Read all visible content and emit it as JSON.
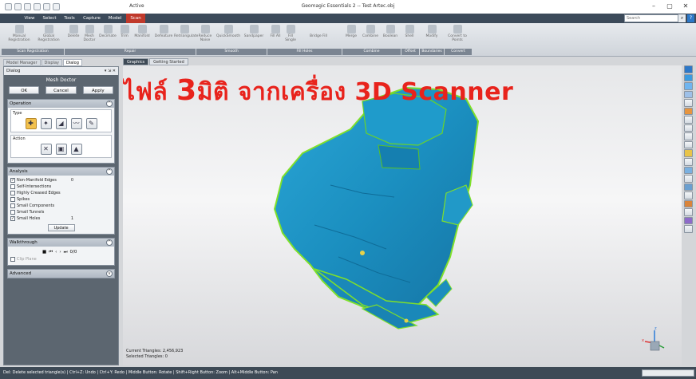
{
  "window": {
    "title": "Geomagic Essentials 2 -- Test Artec.obj",
    "active_context": "Active",
    "minimize": "–",
    "maximize": "▢",
    "close": "✕"
  },
  "tabs": [
    "View",
    "Select",
    "Tools",
    "Capture",
    "Model",
    "Scan"
  ],
  "active_tab": "Scan",
  "search": {
    "placeholder": "Search",
    "icon": "search-icon",
    "help": "?"
  },
  "ribbon": {
    "buttons": [
      {
        "label": "Manual Registration",
        "icon": "manual-registration-icon"
      },
      {
        "label": "Global Registration",
        "icon": "global-registration-icon"
      },
      {
        "label": "Delete",
        "icon": "delete-icon"
      },
      {
        "label": "Mesh Doctor",
        "icon": "mesh-doctor-icon"
      },
      {
        "label": "Decimate",
        "icon": "decimate-icon"
      },
      {
        "label": "Trim",
        "icon": "trim-icon"
      },
      {
        "label": "Manifold",
        "icon": "manifold-icon"
      },
      {
        "label": "Defeature",
        "icon": "defeature-icon"
      },
      {
        "label": "Retriangulate",
        "icon": "retriangulate-icon"
      },
      {
        "label": "Reduce Noise",
        "icon": "reduce-noise-icon"
      },
      {
        "label": "QuickSmooth",
        "icon": "quicksmooth-icon"
      },
      {
        "label": "Sandpaper",
        "icon": "sandpaper-icon"
      },
      {
        "label": "Fill All",
        "icon": "fill-all-icon"
      },
      {
        "label": "Fill Single",
        "icon": "fill-single-icon"
      },
      {
        "label": "Bridge Fill",
        "icon": "bridge-fill-icon"
      },
      {
        "label": "Merge",
        "icon": "merge-icon"
      },
      {
        "label": "Combine",
        "icon": "combine-icon"
      },
      {
        "label": "Boolean",
        "icon": "boolean-icon"
      },
      {
        "label": "Shell",
        "icon": "shell-icon"
      },
      {
        "label": "Modify",
        "icon": "modify-icon"
      },
      {
        "label": "Convert to Points",
        "icon": "convert-to-points-icon"
      }
    ],
    "groups": [
      "Scan Registration",
      "Repair",
      "Smooth",
      "Fill Holes",
      "Combine",
      "Offset",
      "Boundaries",
      "Convert"
    ]
  },
  "left_tabs": [
    "Model Manager",
    "Display",
    "Dialog"
  ],
  "dialog": {
    "header": "Dialog",
    "header_controls": "▾ ⇲ ✕",
    "title": "Mesh Doctor",
    "ok": "OK",
    "cancel": "Cancel",
    "apply": "Apply",
    "operation": {
      "title": "Operation",
      "type_label": "Type",
      "action_label": "Action",
      "type_icons": [
        "auto-repair-icon",
        "remove-spikes-icon",
        "fill-holes-icon",
        "smooth-icon",
        "defeature-icon"
      ],
      "action_icons": [
        "delete-icon",
        "repair-icon",
        "fill-icon"
      ]
    },
    "analysis": {
      "title": "Analysis",
      "items": [
        {
          "label": "Non-Manifold Edges",
          "checked": true,
          "count": "0"
        },
        {
          "label": "Self-Intersections",
          "checked": false,
          "count": ""
        },
        {
          "label": "Highly Creased Edges",
          "checked": false,
          "count": ""
        },
        {
          "label": "Spikes",
          "checked": false,
          "count": ""
        },
        {
          "label": "Small Components",
          "checked": false,
          "count": ""
        },
        {
          "label": "Small Tunnels",
          "checked": false,
          "count": ""
        },
        {
          "label": "Small Holes",
          "checked": true,
          "count": "1"
        }
      ],
      "update": "Update"
    },
    "walkthrough": {
      "title": "Walkthrough",
      "counter": "0/0",
      "clip_plane": "Clip Plane"
    },
    "advanced": {
      "title": "Advanced"
    }
  },
  "graphics_tabs": [
    "Graphics",
    "Getting Started"
  ],
  "overlay": {
    "part1": "ไฟล์ ",
    "part2": "3",
    "part3": "มิติ จากเครื่อง 3D Scanner"
  },
  "stats": {
    "current_triangles": "Current Triangles: 2,456,923",
    "selected_triangles": "Selected Triangles: 0"
  },
  "statusbar": "Del: Delete selected triangle(s) | Ctrl+Z: Undo | Ctrl+Y: Redo | Middle Button: Rotate | Shift+Right Button: Zoom | Alt+Middle Button: Pan",
  "colors": {
    "mesh": "#1b8fc0",
    "mesh_edge": "#7fe02a",
    "scan_tab": "#c0392b",
    "overlay_text": "#e8231c"
  }
}
